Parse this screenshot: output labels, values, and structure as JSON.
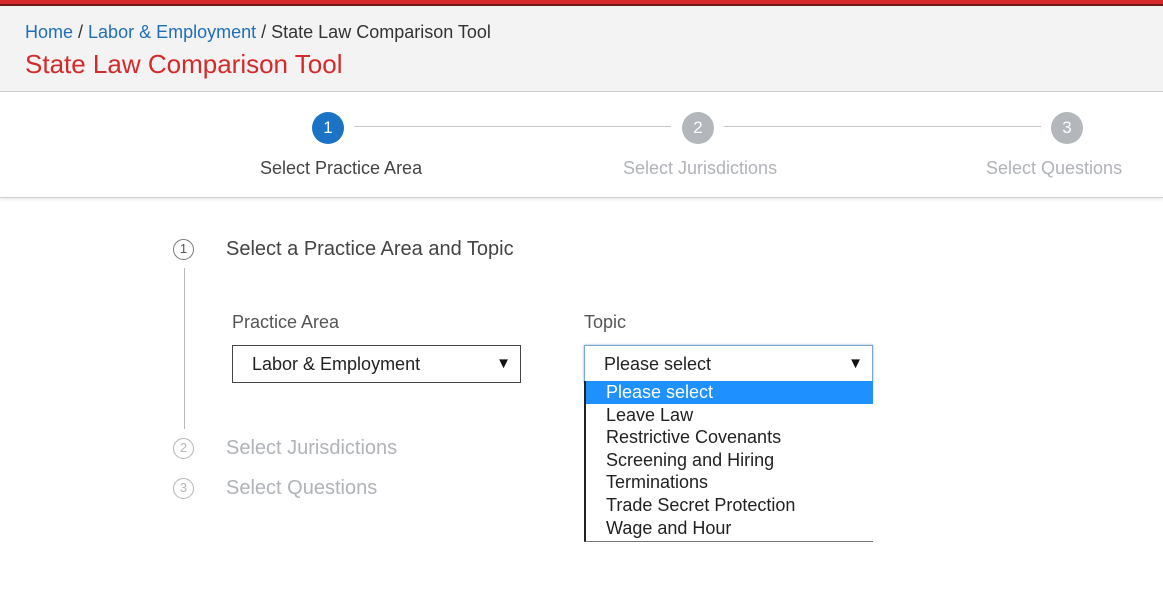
{
  "breadcrumb": {
    "home": "Home",
    "sep1": "/",
    "section": "Labor & Employment",
    "sep2": "/",
    "current": "State Law Comparison Tool"
  },
  "page_title": "State Law Comparison Tool",
  "stepper": {
    "steps": [
      {
        "number": "1",
        "label": "Select Practice Area",
        "state": "active"
      },
      {
        "number": "2",
        "label": "Select Jurisdictions",
        "state": "inactive"
      },
      {
        "number": "3",
        "label": "Select Questions",
        "state": "inactive"
      }
    ]
  },
  "sections": [
    {
      "number": "1",
      "title": "Select a Practice Area and Topic",
      "state": "active"
    },
    {
      "number": "2",
      "title": "Select Jurisdictions",
      "state": "inactive"
    },
    {
      "number": "3",
      "title": "Select Questions",
      "state": "inactive"
    }
  ],
  "form": {
    "practice_area": {
      "label": "Practice Area",
      "value": "Labor & Employment",
      "arrow": "▼"
    },
    "topic": {
      "label": "Topic",
      "value": "Please select",
      "arrow": "▼",
      "options": [
        "Please select",
        "Leave Law",
        "Restrictive Covenants",
        "Screening and Hiring",
        "Terminations",
        "Trade Secret Protection",
        "Wage and Hour"
      ],
      "highlighted_index": 0
    }
  },
  "colors": {
    "accent_red": "#d42a2a",
    "link_blue": "#1f6fb8",
    "step_active": "#1a73c5",
    "step_inactive": "#b3b6ba",
    "option_highlight": "#1e90ff"
  }
}
